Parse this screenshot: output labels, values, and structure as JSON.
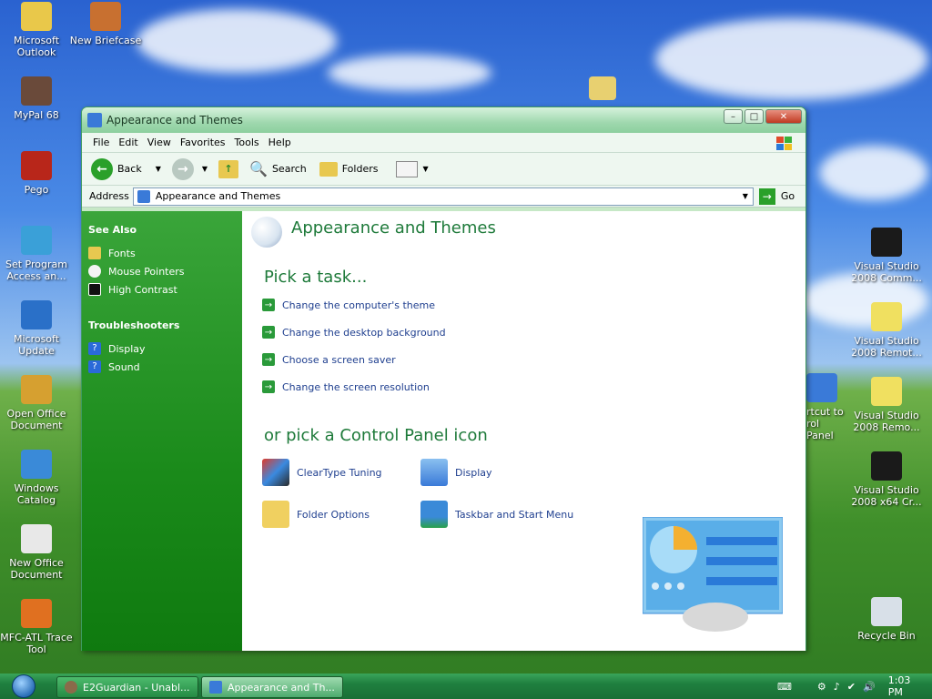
{
  "desktop": {
    "left_icons": [
      {
        "label1": "Microsoft",
        "label2": "Outlook",
        "icon": "outlook-icon",
        "color": "#e9c84a"
      },
      {
        "label1": "MyPal 68",
        "label2": "",
        "icon": "mypal-icon",
        "color": "#6a4a3a"
      },
      {
        "label1": "Pego",
        "label2": "",
        "icon": "pego-icon",
        "color": "#b8261a"
      },
      {
        "label1": "Set Program",
        "label2": "Access an...",
        "icon": "set-program-access-icon",
        "color": "#3aa0d8"
      },
      {
        "label1": "Microsoft",
        "label2": "Update",
        "icon": "microsoft-update-icon",
        "color": "#2a70c8"
      },
      {
        "label1": "Open Office",
        "label2": "Document",
        "icon": "open-office-document-icon",
        "color": "#d6a030"
      },
      {
        "label1": "Windows",
        "label2": "Catalog",
        "icon": "windows-catalog-icon",
        "color": "#3a8ad8"
      },
      {
        "label1": "New Office",
        "label2": "Document",
        "icon": "new-office-document-icon",
        "color": "#e8e8e8"
      },
      {
        "label1": "MFC-ATL Trace",
        "label2": "Tool",
        "icon": "mfc-atl-trace-icon",
        "color": "#e07020"
      }
    ],
    "briefcase": {
      "label": "New Briefcase",
      "icon": "briefcase-icon",
      "color": "#c87030"
    },
    "zip_icon": {
      "icon": "zip-folder-icon",
      "color": "#e8d070"
    },
    "right_icons": [
      {
        "label1": "Visual Studio",
        "label2": "2008 Comm...",
        "icon": "command-prompt-icon",
        "color": "#1a1a1a"
      },
      {
        "label1": "Visual Studio",
        "label2": "2008 Remot...",
        "icon": "remote-debugger-icon",
        "color": "#f0e060"
      },
      {
        "label1": "Visual Studio",
        "label2": "2008 Remo...",
        "icon": "remote-debugger-icon",
        "color": "#f0e060"
      },
      {
        "label1": "Visual Studio",
        "label2": "2008 x64 Cr...",
        "icon": "command-prompt-icon",
        "color": "#1a1a1a"
      },
      {
        "label1": "Recycle Bin",
        "label2": "",
        "icon": "recycle-bin-icon",
        "color": "#d8e0e8"
      }
    ],
    "shortcut_partial": {
      "label1": "rtcut to",
      "label2": "rol Panel",
      "icon": "control-panel-shortcut-icon"
    }
  },
  "window": {
    "title": "Appearance and Themes",
    "menu": [
      "File",
      "Edit",
      "View",
      "Favorites",
      "Tools",
      "Help"
    ],
    "toolbar": {
      "back": "Back",
      "search": "Search",
      "folders": "Folders"
    },
    "address_label": "Address",
    "address_value": "Appearance and Themes",
    "go": "Go",
    "sidebar": {
      "see_also_title": "See Also",
      "see_also": [
        {
          "label": "Fonts",
          "icon": "fonts-folder-icon"
        },
        {
          "label": "Mouse Pointers",
          "icon": "mouse-pointers-icon"
        },
        {
          "label": "High Contrast",
          "icon": "high-contrast-icon"
        }
      ],
      "troubleshooters_title": "Troubleshooters",
      "troubleshooters": [
        {
          "label": "Display",
          "icon": "help-icon"
        },
        {
          "label": "Sound",
          "icon": "help-icon"
        }
      ]
    },
    "main": {
      "heading": "Appearance and Themes",
      "pick_task": "Pick a task...",
      "tasks": [
        "Change the computer's theme",
        "Change the desktop background",
        "Choose a screen saver",
        "Change the screen resolution"
      ],
      "or_pick": "or pick a Control Panel icon",
      "icons": [
        {
          "label": "ClearType Tuning",
          "icon": "cleartype-icon"
        },
        {
          "label": "Display",
          "icon": "display-icon"
        },
        {
          "label": "Folder Options",
          "icon": "folder-options-icon"
        },
        {
          "label": "Taskbar and Start Menu",
          "icon": "taskbar-start-menu-icon"
        }
      ]
    }
  },
  "taskbar": {
    "buttons": [
      {
        "label": "E2Guardian - Unabl...",
        "icon": "e2guardian-icon",
        "active": false
      },
      {
        "label": "Appearance and Th...",
        "icon": "control-panel-icon",
        "active": true
      }
    ],
    "clock": "1:03 PM"
  },
  "colors": {
    "accent_green": "#1e7a3a",
    "link_blue": "#1f3f8f",
    "sidebar_green": "#1a8a1a"
  }
}
